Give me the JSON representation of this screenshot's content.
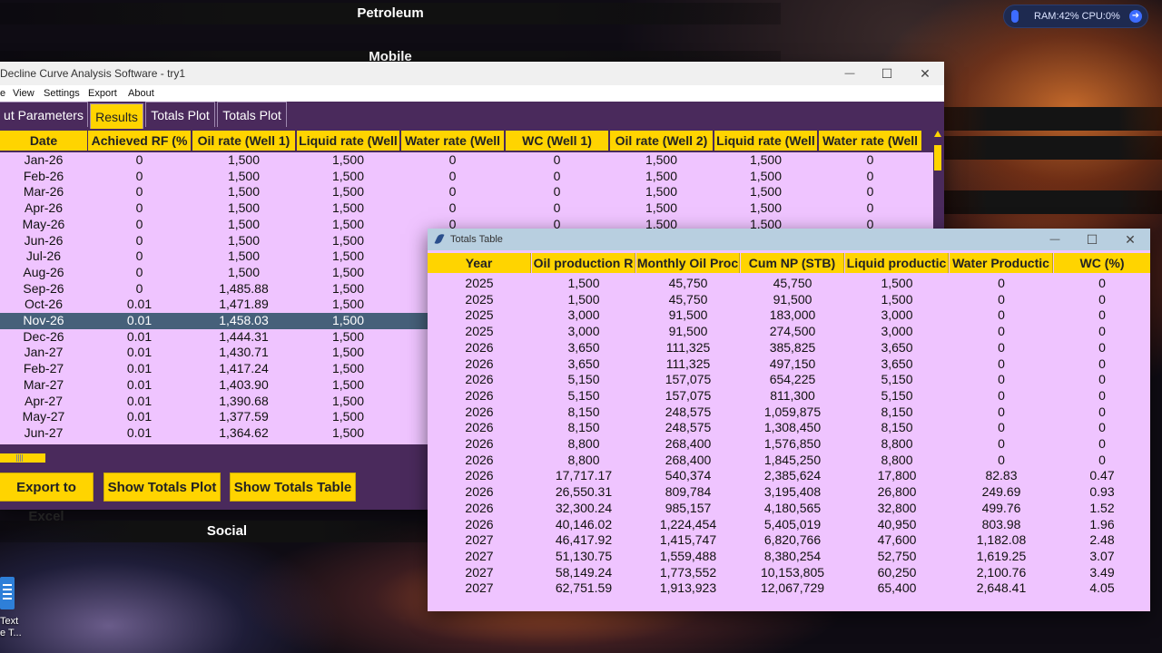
{
  "desktop": {
    "ribbon_petroleum": "Petroleum",
    "ribbon_mobile": "Mobile",
    "ribbon_social": "Social",
    "sysmon": "RAM:42%  CPU:0%",
    "desktop_icon_label": "Text\ne T..."
  },
  "main_window": {
    "title": " Decline Curve Analysis Software - try1",
    "menu": [
      "e",
      "View",
      "Settings",
      "Export",
      "About"
    ],
    "tabs": [
      "ut Parameters",
      "Results",
      "Totals Plot",
      "Totals Plot"
    ],
    "active_tab_index": 1,
    "columns": [
      "Date",
      "Achieved RF (%",
      "Oil rate (Well 1)",
      "Liquid rate (Well",
      "Water rate (Well",
      "WC (Well 1)",
      "Oil rate (Well 2)",
      "Liquid rate (Well",
      "Water rate (Well"
    ],
    "rows": [
      [
        "Jan-26",
        "0",
        "1,500",
        "1,500",
        "0",
        "0",
        "1,500",
        "1,500",
        "0"
      ],
      [
        "Feb-26",
        "0",
        "1,500",
        "1,500",
        "0",
        "0",
        "1,500",
        "1,500",
        "0"
      ],
      [
        "Mar-26",
        "0",
        "1,500",
        "1,500",
        "0",
        "0",
        "1,500",
        "1,500",
        "0"
      ],
      [
        "Apr-26",
        "0",
        "1,500",
        "1,500",
        "0",
        "0",
        "1,500",
        "1,500",
        "0"
      ],
      [
        "May-26",
        "0",
        "1,500",
        "1,500",
        "0",
        "0",
        "1,500",
        "1,500",
        "0"
      ],
      [
        "Jun-26",
        "0",
        "1,500",
        "1,500",
        "",
        "",
        "",
        "",
        ""
      ],
      [
        "Jul-26",
        "0",
        "1,500",
        "1,500",
        "",
        "",
        "",
        "",
        ""
      ],
      [
        "Aug-26",
        "0",
        "1,500",
        "1,500",
        "",
        "",
        "",
        "",
        ""
      ],
      [
        "Sep-26",
        "0",
        "1,485.88",
        "1,500",
        "",
        "",
        "",
        "",
        ""
      ],
      [
        "Oct-26",
        "0.01",
        "1,471.89",
        "1,500",
        "",
        "",
        "",
        "",
        ""
      ],
      [
        "Nov-26",
        "0.01",
        "1,458.03",
        "1,500",
        "",
        "",
        "",
        "",
        ""
      ],
      [
        "Dec-26",
        "0.01",
        "1,444.31",
        "1,500",
        "",
        "",
        "",
        "",
        ""
      ],
      [
        "Jan-27",
        "0.01",
        "1,430.71",
        "1,500",
        "",
        "",
        "",
        "",
        ""
      ],
      [
        "Feb-27",
        "0.01",
        "1,417.24",
        "1,500",
        "",
        "",
        "",
        "",
        ""
      ],
      [
        "Mar-27",
        "0.01",
        "1,403.90",
        "1,500",
        "",
        "",
        "",
        "",
        ""
      ],
      [
        "Apr-27",
        "0.01",
        "1,390.68",
        "1,500",
        "",
        "",
        "",
        "",
        ""
      ],
      [
        "May-27",
        "0.01",
        "1,377.59",
        "1,500",
        "",
        "",
        "",
        "",
        ""
      ],
      [
        "Jun-27",
        "0.01",
        "1,364.62",
        "1,500",
        "",
        "",
        "",
        "",
        ""
      ]
    ],
    "selected_row_index": 10,
    "buttons": [
      "Export to Excel",
      "Show Totals Plot",
      "Show Totals Table"
    ]
  },
  "totals_window": {
    "title": "Totals Table",
    "columns": [
      "Year",
      "Oil production R",
      "Monthly Oil Proc",
      "Cum NP (STB)",
      "Liquid productic",
      "Water Productic",
      "WC (%)"
    ],
    "rows": [
      [
        "2025",
        "1,500",
        "45,750",
        "45,750",
        "1,500",
        "0",
        "0"
      ],
      [
        "2025",
        "1,500",
        "45,750",
        "91,500",
        "1,500",
        "0",
        "0"
      ],
      [
        "2025",
        "3,000",
        "91,500",
        "183,000",
        "3,000",
        "0",
        "0"
      ],
      [
        "2025",
        "3,000",
        "91,500",
        "274,500",
        "3,000",
        "0",
        "0"
      ],
      [
        "2026",
        "3,650",
        "111,325",
        "385,825",
        "3,650",
        "0",
        "0"
      ],
      [
        "2026",
        "3,650",
        "111,325",
        "497,150",
        "3,650",
        "0",
        "0"
      ],
      [
        "2026",
        "5,150",
        "157,075",
        "654,225",
        "5,150",
        "0",
        "0"
      ],
      [
        "2026",
        "5,150",
        "157,075",
        "811,300",
        "5,150",
        "0",
        "0"
      ],
      [
        "2026",
        "8,150",
        "248,575",
        "1,059,875",
        "8,150",
        "0",
        "0"
      ],
      [
        "2026",
        "8,150",
        "248,575",
        "1,308,450",
        "8,150",
        "0",
        "0"
      ],
      [
        "2026",
        "8,800",
        "268,400",
        "1,576,850",
        "8,800",
        "0",
        "0"
      ],
      [
        "2026",
        "8,800",
        "268,400",
        "1,845,250",
        "8,800",
        "0",
        "0"
      ],
      [
        "2026",
        "17,717.17",
        "540,374",
        "2,385,624",
        "17,800",
        "82.83",
        "0.47"
      ],
      [
        "2026",
        "26,550.31",
        "809,784",
        "3,195,408",
        "26,800",
        "249.69",
        "0.93"
      ],
      [
        "2026",
        "32,300.24",
        "985,157",
        "4,180,565",
        "32,800",
        "499.76",
        "1.52"
      ],
      [
        "2026",
        "40,146.02",
        "1,224,454",
        "5,405,019",
        "40,950",
        "803.98",
        "1.96"
      ],
      [
        "2027",
        "46,417.92",
        "1,415,747",
        "6,820,766",
        "47,600",
        "1,182.08",
        "2.48"
      ],
      [
        "2027",
        "51,130.75",
        "1,559,488",
        "8,380,254",
        "52,750",
        "1,619.25",
        "3.07"
      ],
      [
        "2027",
        "58,149.24",
        "1,773,552",
        "10,153,805",
        "60,250",
        "2,100.76",
        "3.49"
      ],
      [
        "2027",
        "62,751.59",
        "1,913,923",
        "12,067,729",
        "65,400",
        "2,648.41",
        "4.05"
      ]
    ]
  },
  "window_controls": {
    "minimize": "—",
    "maximize": "☐",
    "close": "✕"
  },
  "colors": {
    "accent_yellow": "#ffd400",
    "panel_purple": "#4a2a5c",
    "grid_bg": "#efc4ff",
    "selection": "#46607a"
  }
}
